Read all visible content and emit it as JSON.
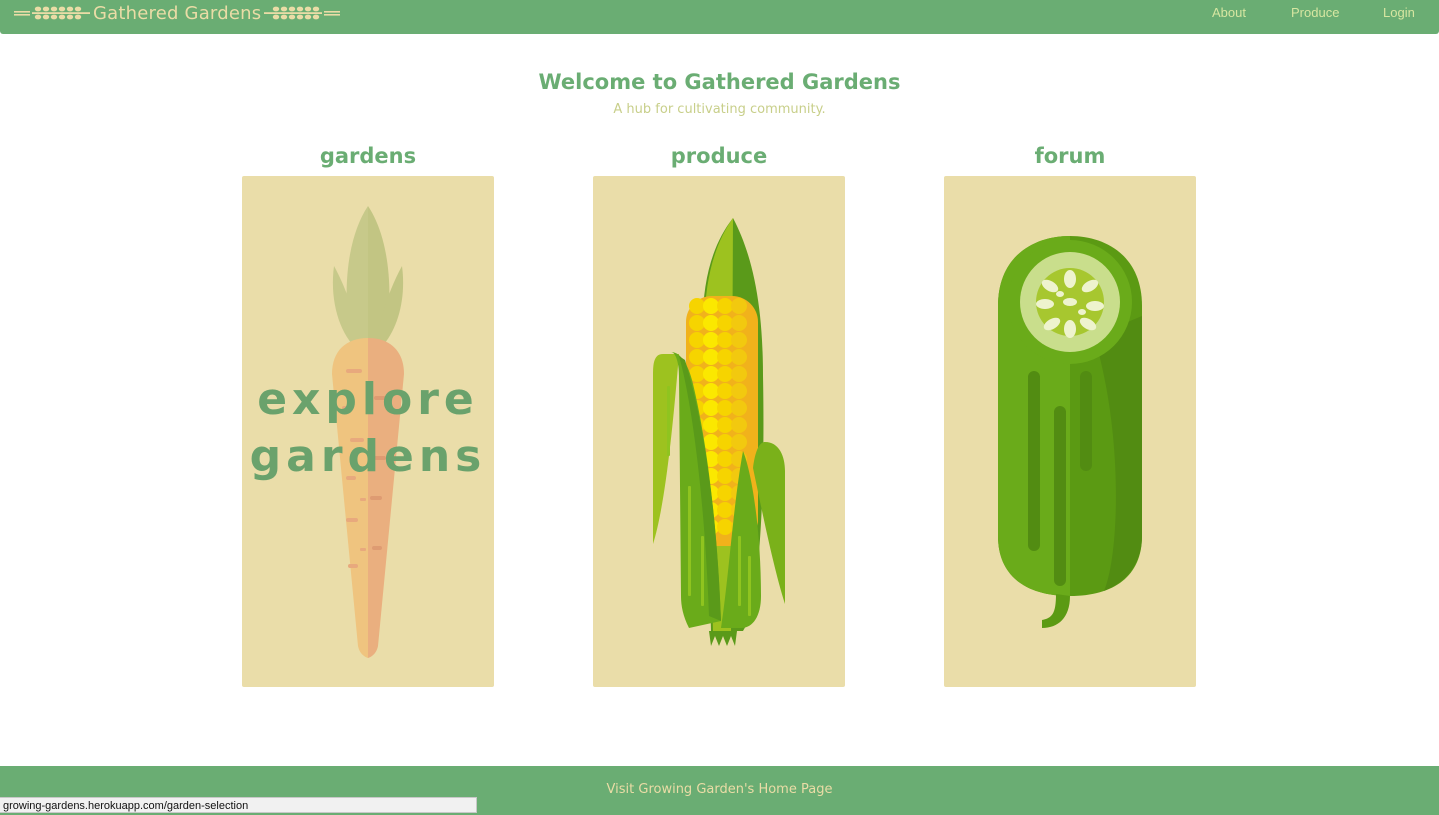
{
  "navbar": {
    "brand": "Gathered Gardens",
    "links": [
      "About",
      "Produce",
      "Login"
    ]
  },
  "hero": {
    "title": "Welcome to Gathered Gardens",
    "subtitle": "A hub for cultivating community."
  },
  "cards": [
    {
      "heading": "gardens",
      "overlay_line1": "explore",
      "overlay_line2": "gardens",
      "image": "carrot-icon"
    },
    {
      "heading": "produce",
      "image": "corn-icon"
    },
    {
      "heading": "forum",
      "image": "cucumber-icon"
    }
  ],
  "footer": {
    "link": "Visit Growing Garden's Home Page"
  },
  "status_bar": {
    "url": "growing-gardens.herokuapp.com/garden-selection"
  },
  "colors": {
    "primary_green": "#6aad73",
    "card_bg": "#eadda9",
    "brand_text": "#eadca6"
  }
}
